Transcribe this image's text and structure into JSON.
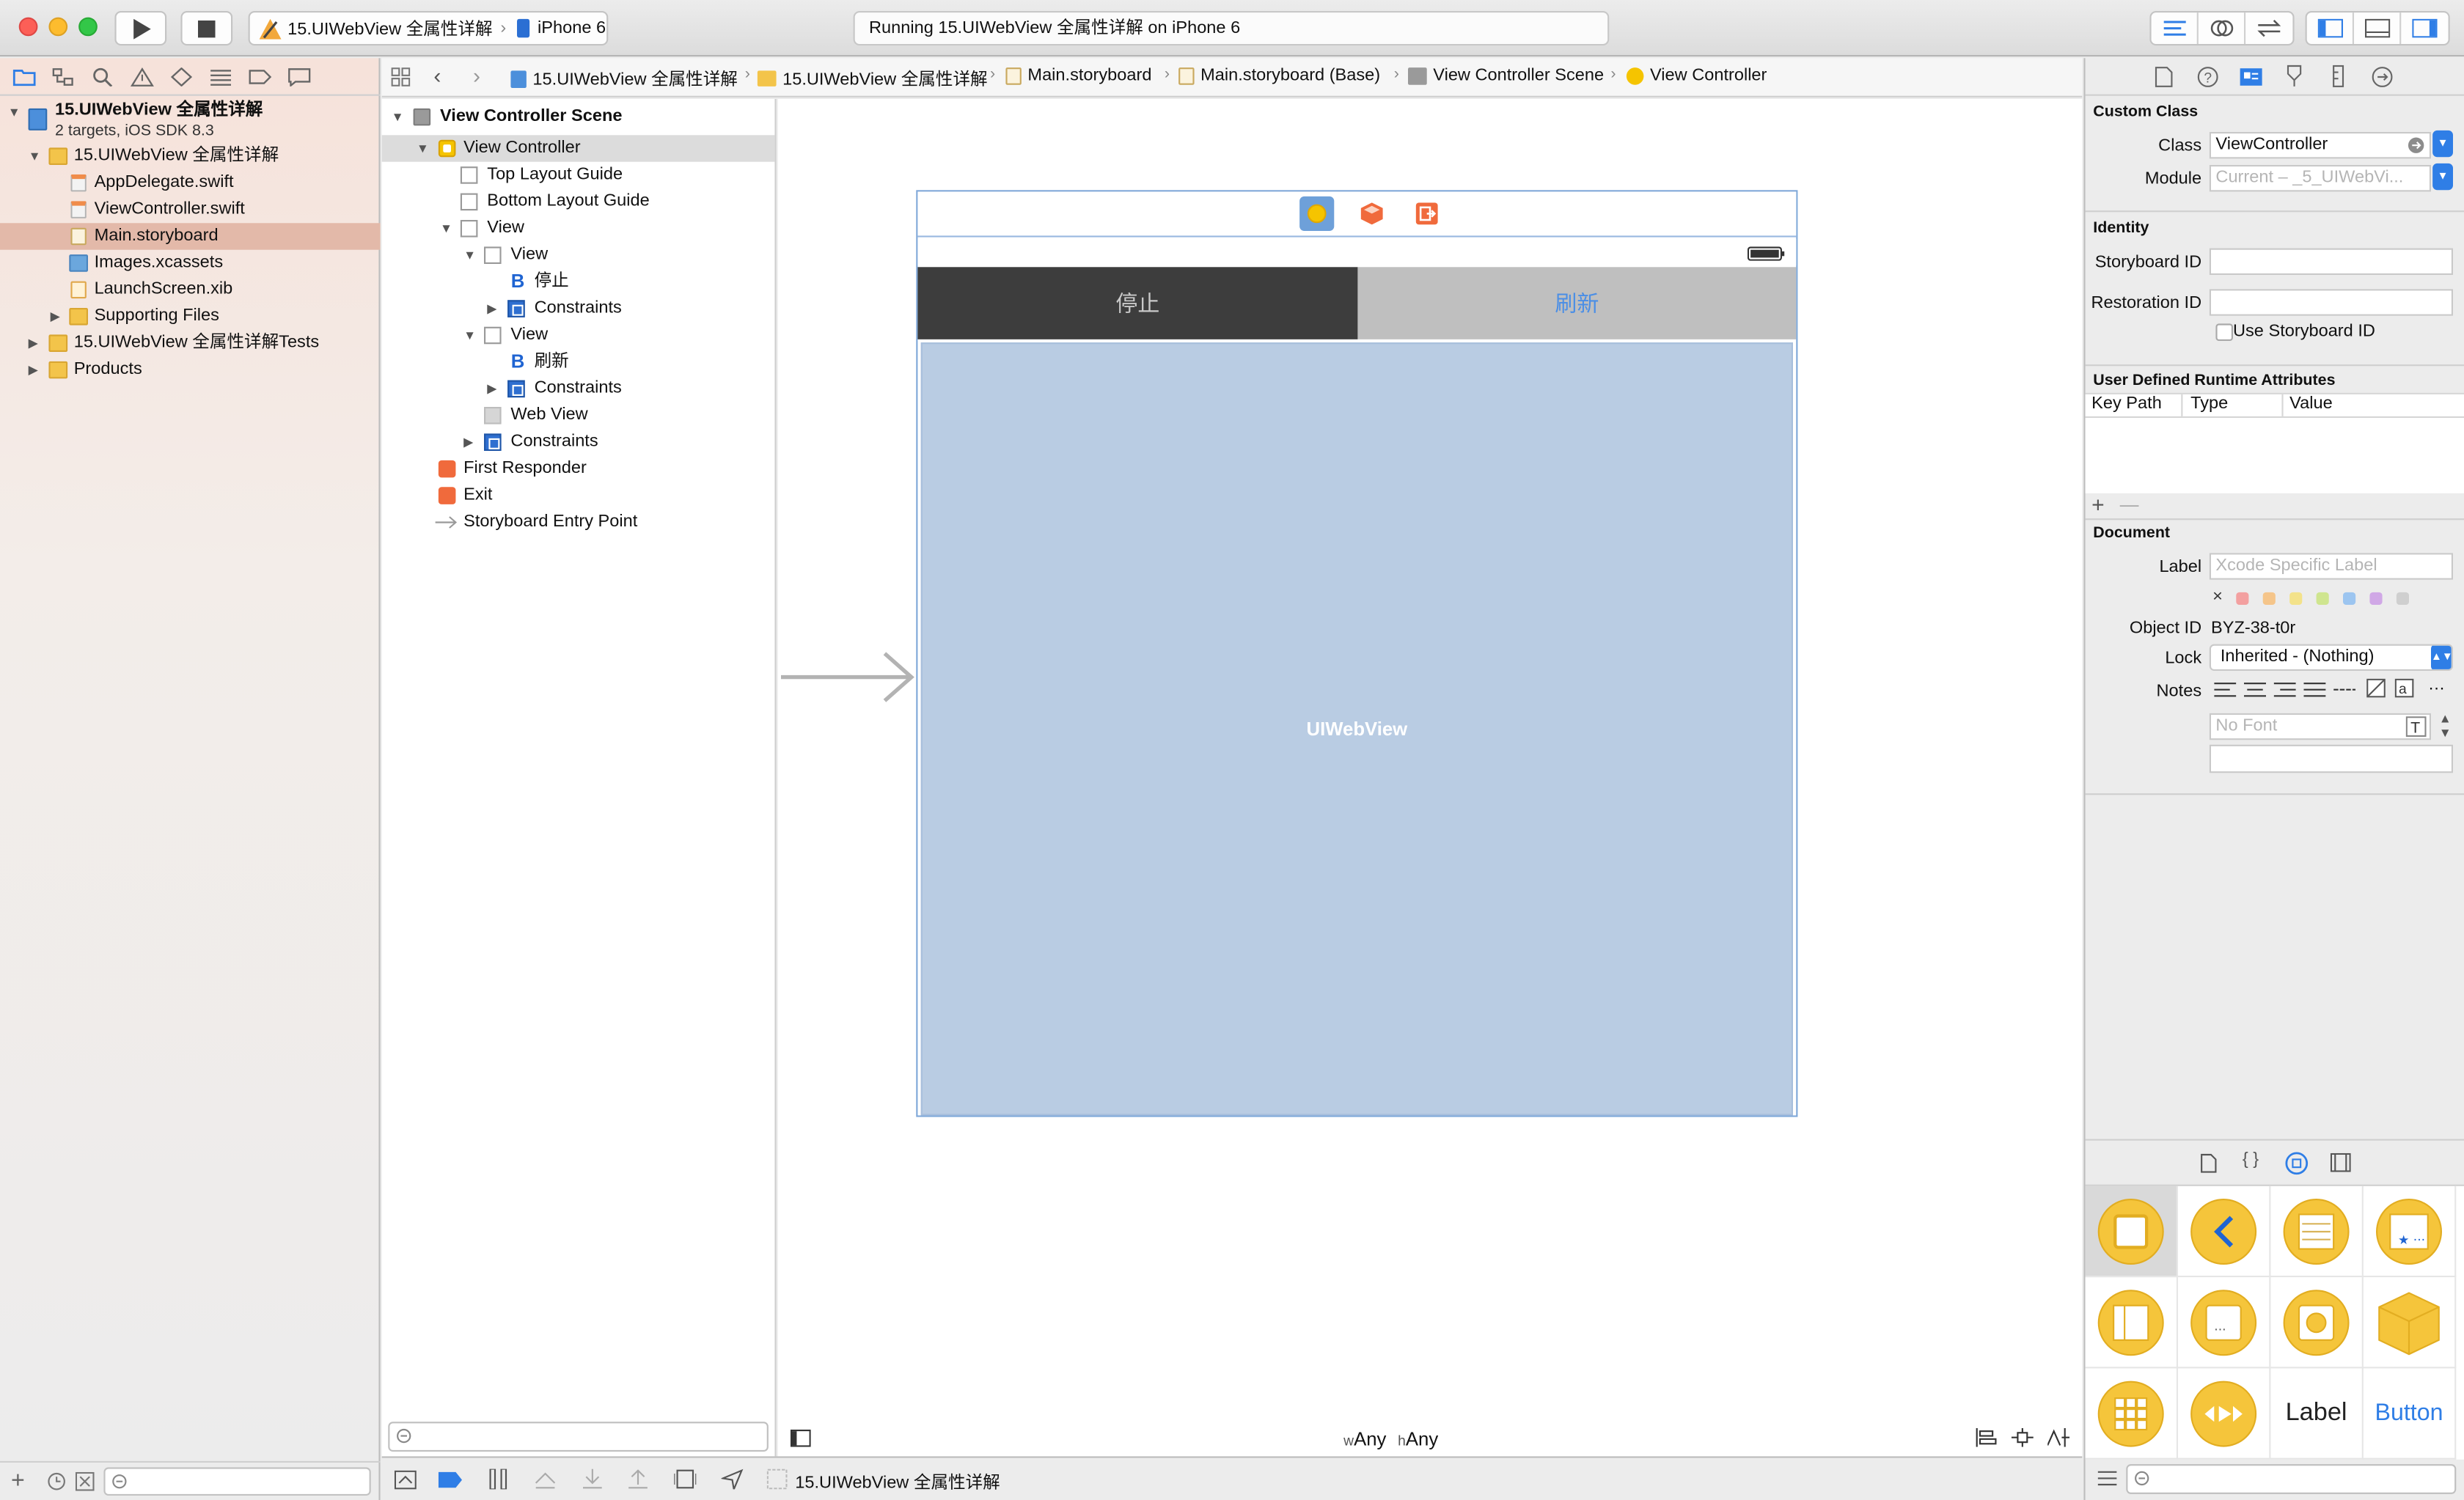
{
  "toolbar": {
    "scheme_project": "15.UIWebView 全属性详解",
    "scheme_device": "iPhone 6",
    "activity_status": "Running 15.UIWebView 全属性详解 on iPhone 6"
  },
  "navigator": {
    "project_name": "15.UIWebView 全属性详解",
    "project_subtitle": "2 targets, iOS SDK 8.3",
    "items": [
      {
        "label": "15.UIWebView 全属性详解",
        "type": "folder"
      },
      {
        "label": "AppDelegate.swift",
        "type": "swift"
      },
      {
        "label": "ViewController.swift",
        "type": "swift"
      },
      {
        "label": "Main.storyboard",
        "type": "storyboard"
      },
      {
        "label": "Images.xcassets",
        "type": "assets"
      },
      {
        "label": "LaunchScreen.xib",
        "type": "xib"
      },
      {
        "label": "Supporting Files",
        "type": "folder"
      },
      {
        "label": "15.UIWebView 全属性详解Tests",
        "type": "folder"
      },
      {
        "label": "Products",
        "type": "folder"
      }
    ]
  },
  "jumpbar": {
    "crumbs": [
      "15.UIWebView 全属性详解",
      "15.UIWebView 全属性详解",
      "Main.storyboard",
      "Main.storyboard (Base)",
      "View Controller Scene",
      "View Controller"
    ]
  },
  "outline": {
    "scene_title": "View Controller Scene",
    "rows": [
      "View Controller",
      "Top Layout Guide",
      "Bottom Layout Guide",
      "View",
      "View",
      "停止",
      "Constraints",
      "View",
      "刷新",
      "Constraints",
      "Web View",
      "Constraints",
      "First Responder",
      "Exit",
      "Storyboard Entry Point"
    ]
  },
  "canvas": {
    "stop_button": "停止",
    "refresh_button": "刷新",
    "webview_label": "UIWebView",
    "size_w_prefix": "w",
    "size_w": "Any",
    "size_h_prefix": "h",
    "size_h": "Any"
  },
  "debugbar": {
    "target": "15.UIWebView 全属性详解"
  },
  "inspector": {
    "custom_class": {
      "title": "Custom Class",
      "class_label": "Class",
      "class_value": "ViewController",
      "module_label": "Module",
      "module_placeholder": "Current – _5_UIWebVi..."
    },
    "identity": {
      "title": "Identity",
      "storyboard_id_label": "Storyboard ID",
      "restoration_id_label": "Restoration ID",
      "use_storyboard_id": "Use Storyboard ID"
    },
    "runtime": {
      "title": "User Defined Runtime Attributes",
      "col_keypath": "Key Path",
      "col_type": "Type",
      "col_value": "Value",
      "add": "+",
      "remove": "—"
    },
    "document": {
      "title": "Document",
      "label_label": "Label",
      "label_placeholder": "Xcode Specific Label",
      "object_id_label": "Object ID",
      "object_id": "BYZ-38-t0r",
      "lock_label": "Lock",
      "lock_value": "Inherited - (Nothing)",
      "notes_label": "Notes",
      "font_placeholder": "No Font",
      "color_clear": "×",
      "label_colors": [
        "#f3a0a0",
        "#f5c58a",
        "#f3e28a",
        "#cfe58f",
        "#9cc5f0",
        "#d0a8e6",
        "#cfcfcf"
      ]
    },
    "library": {
      "label_item": "Label",
      "button_item": "Button"
    }
  },
  "colors": {
    "accent": "#2f7ee6",
    "selection": "#e3b9a9",
    "stop_bg": "#3d3d3d",
    "refresh_bg": "#bfbfbf",
    "webview_bg": "#b9cce3"
  }
}
